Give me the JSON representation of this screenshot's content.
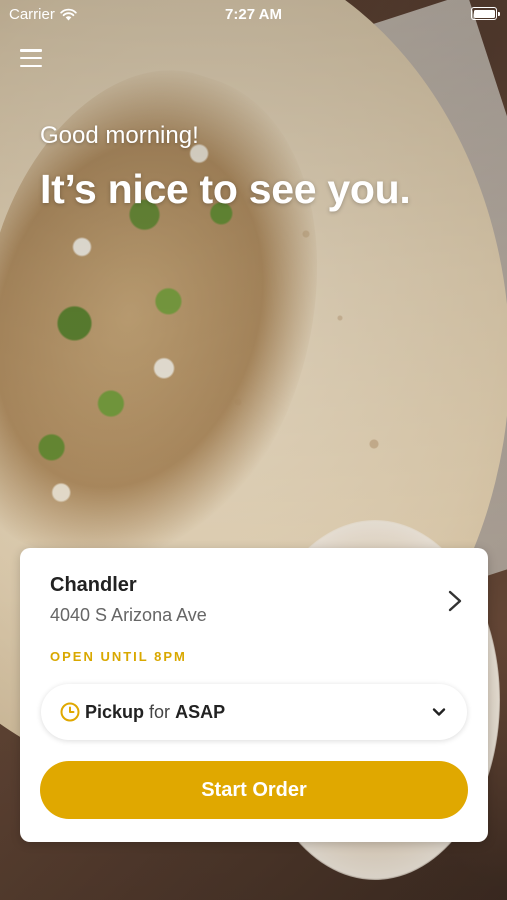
{
  "status_bar": {
    "carrier": "Carrier",
    "time": "7:27 AM",
    "icons": [
      "wifi-icon",
      "battery-icon"
    ]
  },
  "header": {
    "menu_icon": "hamburger-menu-icon"
  },
  "hero": {
    "greeting": "Good morning!",
    "headline": "It’s nice to see you."
  },
  "location_card": {
    "store_name": "Chandler",
    "store_address": "4040 S Arizona Ave",
    "hours_status": "OPEN UNTIL 8PM",
    "chevron_icon": "chevron-right-icon",
    "order_type": {
      "icon": "clock-icon",
      "mode": "Pickup",
      "connector": "for",
      "time": "ASAP",
      "dropdown_icon": "chevron-down-icon"
    },
    "start_button_label": "Start Order"
  },
  "colors": {
    "accent": "#E0A800",
    "hours_text": "#D9A800",
    "card_background": "#FFFFFF",
    "primary_text": "#222222",
    "secondary_text": "#666666"
  }
}
